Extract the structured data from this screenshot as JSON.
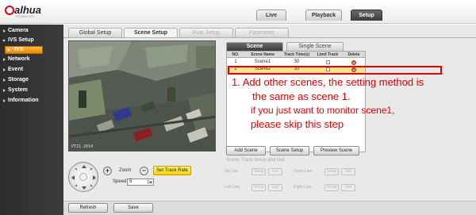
{
  "brand": {
    "logo_text": "alhua",
    "logo_sub": "TECHNOLOGY"
  },
  "top_tabs": [
    {
      "label": "Live"
    },
    {
      "label": "Playback"
    },
    {
      "label": "Setup"
    }
  ],
  "sidebar": {
    "items": [
      {
        "label": "Camera"
      },
      {
        "label": "IVS Setup"
      },
      {
        "label": "IVS"
      },
      {
        "label": "Network"
      },
      {
        "label": "Event"
      },
      {
        "label": "Storage"
      },
      {
        "label": "System"
      },
      {
        "label": "Information"
      }
    ]
  },
  "sub_tabs": [
    {
      "label": "Global Setup"
    },
    {
      "label": "Scene Setup"
    },
    {
      "label": "Rule Setup"
    },
    {
      "label": "Parameter"
    }
  ],
  "video": {
    "timestamp": "PTZ1 2014"
  },
  "scene_tabs": [
    {
      "label": "Scene"
    },
    {
      "label": "Single Scene"
    }
  ],
  "scene_table": {
    "headers": [
      "NO.",
      "Scene Name",
      "Track Time(s)",
      "Limit Track",
      "Delete"
    ],
    "rows": [
      {
        "no": "1",
        "name": "Scene1",
        "time": "30"
      },
      {
        "no": "2",
        "name": "Scene2",
        "time": "30"
      }
    ]
  },
  "scene_buttons": {
    "add": "Add Scene",
    "setup": "Scene Setup",
    "preview": "Preview Scene"
  },
  "annotation": {
    "line1": "1.  Add other scenes, the setting method is",
    "line2": "the same as scene 1.",
    "line3": "if you just want to monitor scene1,",
    "line4": "please skip this step"
  },
  "track": {
    "title": "Scene Track Setup and Get",
    "up_line": "Up Line",
    "down_line": "Down Line",
    "left_line": "Left Line",
    "right_line": "Right Line",
    "setup": "Setup",
    "get": "Get"
  },
  "ptz": {
    "zoom_label": "Zoom",
    "plus": "+",
    "minus": "−",
    "track_rate_button": "Set Track Rate",
    "speed_label": "Speed",
    "speed_value": "5"
  },
  "footer": {
    "refresh": "Refresh",
    "save": "Save"
  },
  "colors": {
    "accent": "#e98a00",
    "annotation": "#e20000",
    "highlight_row": "#f7e58e"
  }
}
